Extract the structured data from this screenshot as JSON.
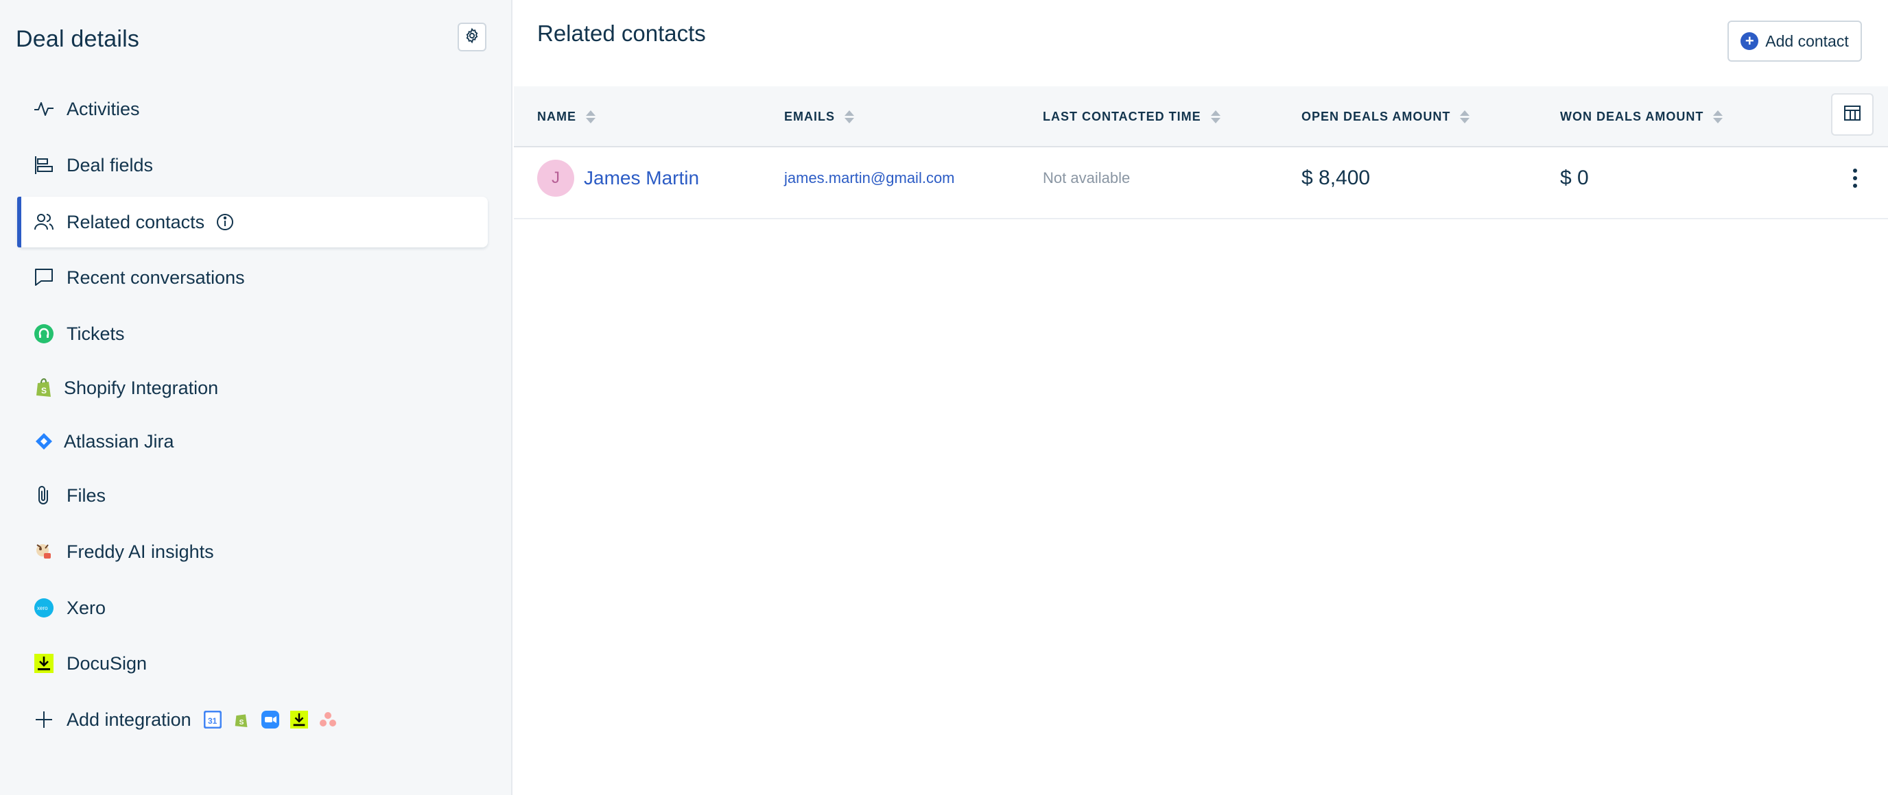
{
  "sidebar": {
    "title": "Deal details",
    "items": [
      {
        "label": "Activities",
        "icon": "activity-icon"
      },
      {
        "label": "Deal fields",
        "icon": "deal-fields-icon"
      },
      {
        "label": "Related contacts",
        "icon": "contacts-icon",
        "active": true
      },
      {
        "label": "Recent conversations",
        "icon": "conversation-icon"
      },
      {
        "label": "Tickets",
        "icon": "tickets-icon"
      },
      {
        "label": "Shopify Integration",
        "icon": "shopify-icon"
      },
      {
        "label": "Atlassian Jira",
        "icon": "jira-icon"
      },
      {
        "label": "Files",
        "icon": "paperclip-icon"
      },
      {
        "label": "Freddy AI insights",
        "icon": "freddy-icon"
      },
      {
        "label": "Xero",
        "icon": "xero-icon"
      },
      {
        "label": "DocuSign",
        "icon": "docusign-icon"
      },
      {
        "label": "Add integration",
        "icon": "plus-icon"
      }
    ]
  },
  "main": {
    "title": "Related contacts",
    "add_contact_label": "Add contact",
    "columns": [
      {
        "label": "NAME"
      },
      {
        "label": "EMAILS"
      },
      {
        "label": "LAST CONTACTED TIME"
      },
      {
        "label": "OPEN DEALS AMOUNT"
      },
      {
        "label": "WON DEALS AMOUNT"
      }
    ],
    "rows": [
      {
        "avatar_initial": "J",
        "name": "James Martin",
        "email": "james.martin@gmail.com",
        "last_contacted": "Not available",
        "open_deals": "$ 8,400",
        "won_deals": "$ 0"
      }
    ]
  },
  "colors": {
    "accent": "#2c5cc5",
    "sidebar_bg": "#f5f7f9",
    "text": "#12344d",
    "avatar_bg": "#f4c6e0"
  }
}
